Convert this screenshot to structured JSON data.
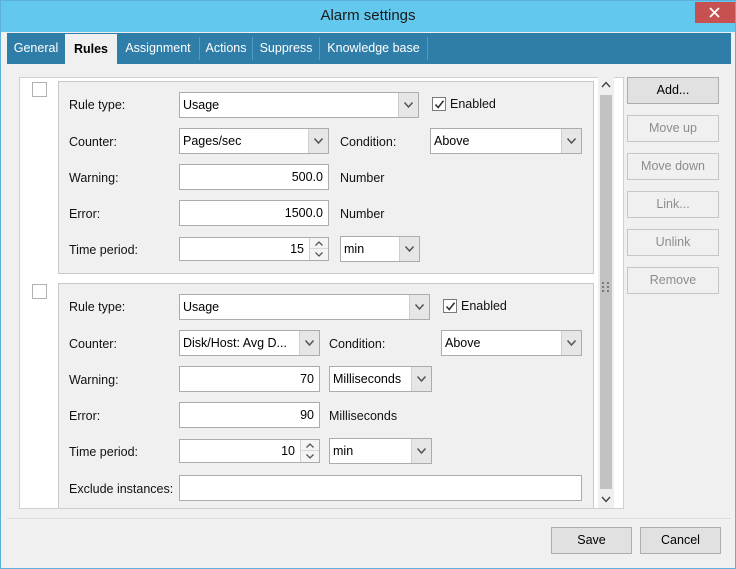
{
  "window": {
    "title": "Alarm settings"
  },
  "tabs": [
    {
      "label": "General"
    },
    {
      "label": "Rules"
    },
    {
      "label": "Assignment"
    },
    {
      "label": "Actions"
    },
    {
      "label": "Suppress"
    },
    {
      "label": "Knowledge base"
    }
  ],
  "active_tab": "Rules",
  "labels": {
    "rule_type": "Rule type:",
    "enabled": "Enabled",
    "counter": "Counter:",
    "condition": "Condition:",
    "warning": "Warning:",
    "error": "Error:",
    "time_period": "Time period:",
    "exclude_instances": "Exclude instances:"
  },
  "rules": [
    {
      "selected": false,
      "rule_type": "Usage",
      "enabled": true,
      "counter": "Pages/sec",
      "condition": "Above",
      "warning": "500.0",
      "warning_unit": "Number",
      "error": "1500.0",
      "error_unit": "Number",
      "time_period": "15",
      "time_unit": "min"
    },
    {
      "selected": false,
      "rule_type": "Usage",
      "enabled": true,
      "counter": "Disk/Host: Avg D...",
      "condition": "Above",
      "warning": "70",
      "warning_unit": "Milliseconds",
      "error": "90",
      "error_unit": "Milliseconds",
      "time_period": "10",
      "time_unit": "min",
      "exclude_instances": ""
    }
  ],
  "side_buttons": {
    "add": "Add...",
    "move_up": "Move up",
    "move_down": "Move down",
    "link": "Link...",
    "unlink": "Unlink",
    "remove": "Remove"
  },
  "footer": {
    "save": "Save",
    "cancel": "Cancel"
  },
  "icons": {
    "close": "close-icon",
    "dropdown": "chevron-down-icon",
    "checkbox_checked": "checkmark-icon",
    "spin_up": "chevron-up-icon",
    "spin_down": "chevron-down-icon",
    "scroll_grip": "grip-icon"
  },
  "colors": {
    "titlebar": "#63c8ee",
    "tabbar": "#2f7ea9",
    "close_button": "#c75050"
  }
}
